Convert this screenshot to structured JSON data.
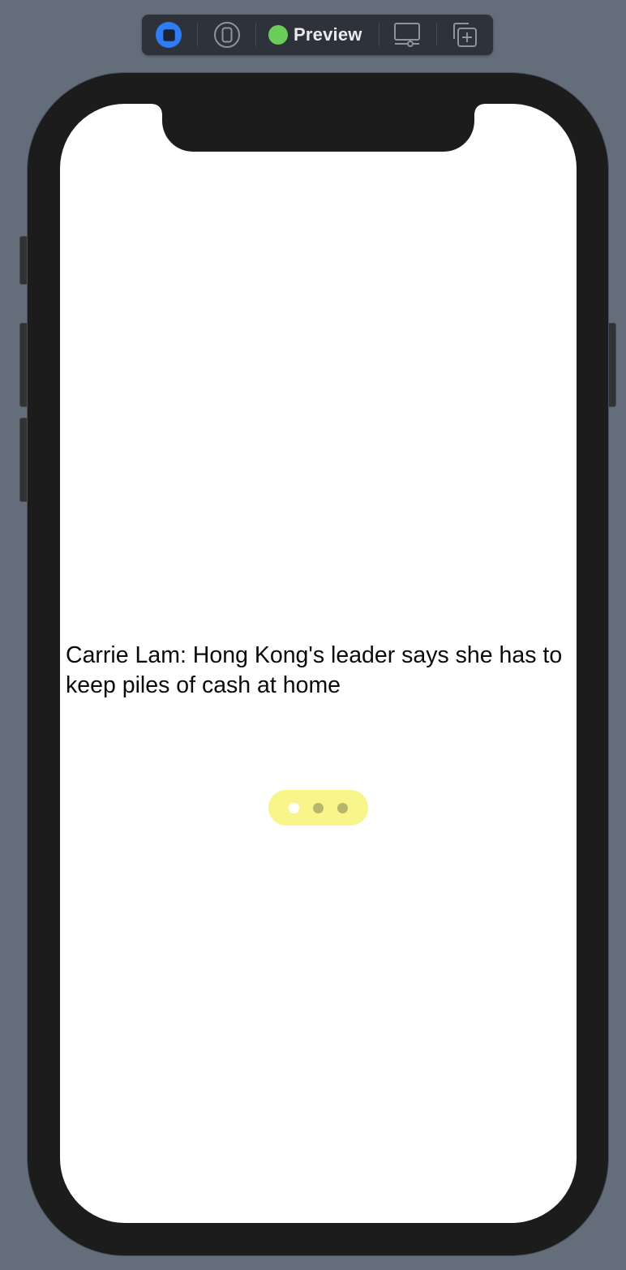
{
  "toolbar": {
    "preview_label": "Preview",
    "icons": {
      "live": "stop-square-icon",
      "device": "device-phone-icon",
      "status": "green-status-dot-icon",
      "settings": "device-settings-icon",
      "duplicate": "duplicate-preview-icon"
    },
    "colors": {
      "live_accent": "#2f7cf6",
      "status_green": "#6acd59"
    }
  },
  "screen": {
    "headline": "Carrie Lam: Hong Kong's leader says she has to keep piles of cash at home",
    "page_indicator": {
      "page_count": 3,
      "current_page_index": 0,
      "background": "#f8f68b",
      "active_color": "#ffffff",
      "inactive_color": "#b8b66b"
    }
  }
}
